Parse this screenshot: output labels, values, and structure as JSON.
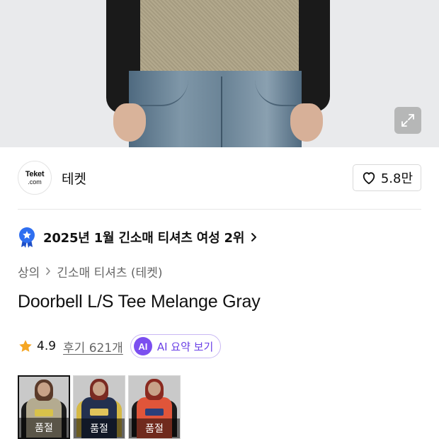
{
  "brand": {
    "logo_line1": "Teket",
    "logo_line2": ".com",
    "name": "테켓"
  },
  "likes": {
    "count": "5.8만"
  },
  "ranking": {
    "text": "2025년 1월 긴소매 티셔츠 여성 2위"
  },
  "breadcrumb": {
    "items": [
      "상의",
      "긴소매 티셔츠 (테켓)"
    ]
  },
  "product": {
    "title": "Doorbell L/S Tee Melange Gray"
  },
  "rating": {
    "value": "4.9",
    "review_label": "후기 621개",
    "ai_badge": "AI",
    "ai_label": "AI 요약 보기"
  },
  "thumbnails": [
    {
      "status": "품절",
      "selected": true
    },
    {
      "status": "품절",
      "selected": false
    },
    {
      "status": "품절",
      "selected": false
    }
  ],
  "colors": {
    "accent_purple": "#7b4ef0",
    "ranking_badge_blue": "#2f6ff0",
    "star_orange": "#f5a623"
  }
}
